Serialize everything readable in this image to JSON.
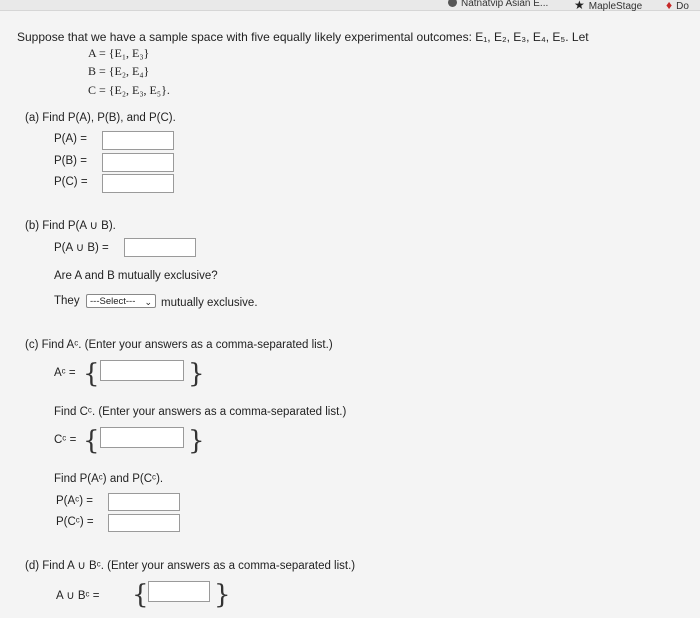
{
  "tabs": {
    "t1": "Natnatvip Asian E...",
    "t2": "MapleStage",
    "t3": "Do"
  },
  "intro": {
    "text": "Suppose that we have a sample space with five equally likely experimental outcomes: E₁, E₂, E₃, E₄, E₅. Let",
    "text_a": "Suppose that we have a sample space with five equally likely experimental outcomes: ",
    "text_b": "Let"
  },
  "sets": {
    "a": "A = {E₁, E₃}",
    "b": "B = {E₂, E₄}",
    "c": "C = {E₂, E₃, E₅}."
  },
  "part_a": {
    "prompt": "(a)  Find P(A), P(B), and P(C).",
    "pa": "P(A)  =",
    "pb": "P(B)  =",
    "pc": "P(C)  ="
  },
  "part_b": {
    "prompt": "(b)  Find P(A ∪ B).",
    "label": "P(A ∪ B) =",
    "question": "Are A and B mutually exclusive?",
    "they": "They",
    "select_value": "---Select---",
    "after": "mutually exclusive."
  },
  "part_c": {
    "prompt": "(c)  Find Aᶜ. (Enter your answers as a comma-separated list.)",
    "ac_label": "Aᶜ =",
    "prompt2": "Find Cᶜ. (Enter your answers as a comma-separated list.)",
    "cc_label": "Cᶜ =",
    "prompt3": "Find P(Aᶜ) and P(Cᶜ).",
    "pac": "P(Aᶜ)  =",
    "pcc": "P(Cᶜ)  ="
  },
  "part_d": {
    "prompt": "(d)  Find A ∪ Bᶜ. (Enter your answers as a comma-separated list.)",
    "label": "A ∪ Bᶜ ="
  }
}
